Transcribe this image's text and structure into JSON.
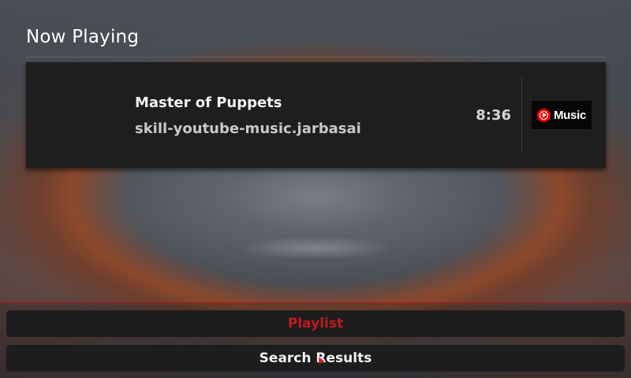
{
  "header": {
    "title": "Now Playing"
  },
  "now_playing": {
    "track_title": "Master of Puppets",
    "source": "skill-youtube-music.jarbasai",
    "duration": "8:36",
    "service_logo": {
      "icon": "youtube-music-icon",
      "label": "Music"
    }
  },
  "bottom_nav": {
    "playlist_label": "Playlist",
    "search_label": "Search Results"
  },
  "colors": {
    "accent": "#c01a1d",
    "card_bg": "#1e1e1e",
    "button_bg": "#1d1d1f"
  }
}
